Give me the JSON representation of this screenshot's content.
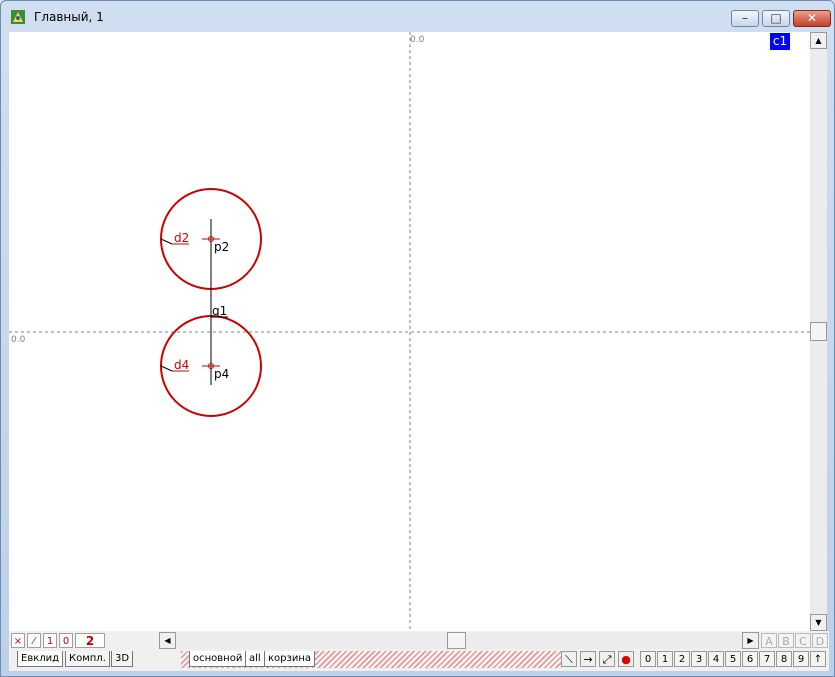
{
  "window": {
    "title": "Главный, 1",
    "buttons": {
      "minimize": "minimize-icon",
      "maximize": "maximize-icon",
      "close": "close-icon"
    }
  },
  "canvas": {
    "axis_label_top": "0.0",
    "axis_label_left": "0.0",
    "corner_badge": "c1",
    "labels": {
      "d2": "d2",
      "p2": "p2",
      "q1": "q1",
      "d4": "d4",
      "p4": "p4"
    },
    "colors": {
      "circle": "#cc0000",
      "axis": "#808080",
      "badge": "#0000ff"
    }
  },
  "toolbar_bottom": {
    "small_buttons": [
      "×",
      "⁄",
      "1",
      "0"
    ],
    "layer_number": "2",
    "letters": [
      "A",
      "B",
      "C",
      "D"
    ],
    "tabs_left": [
      "Евклид",
      "Компл.",
      "3D"
    ],
    "tabs_right": [
      "основной",
      "all",
      "корзина"
    ],
    "tools": [
      "segment-tool-icon",
      "arrow-right-icon",
      "arrow-diagonal-icon",
      "red-dot-icon"
    ],
    "numbers": [
      "0",
      "1",
      "2",
      "3",
      "4",
      "5",
      "6",
      "7",
      "8",
      "9",
      "↑"
    ]
  }
}
